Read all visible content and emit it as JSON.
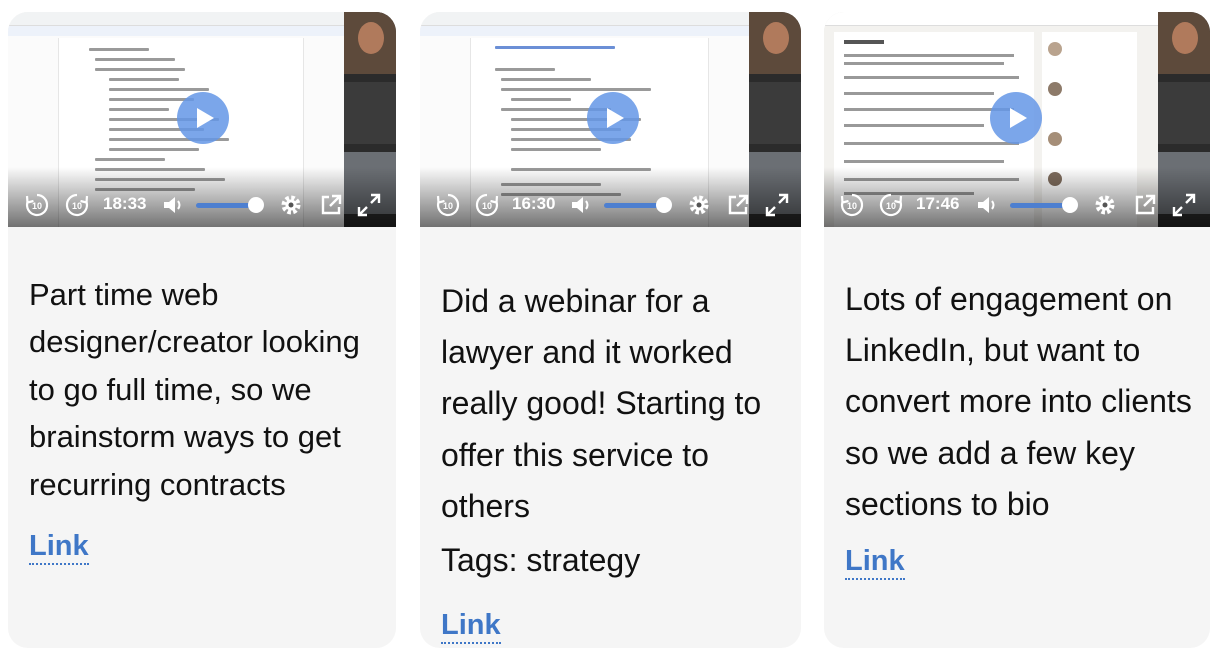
{
  "cards": [
    {
      "video": {
        "time": "18:33",
        "rewind_label": "10",
        "forward_label": "10"
      },
      "description": "Part time web designer/creator looking to go full time, so we brainstorm ways to get recurring contracts",
      "link_label": "Link"
    },
    {
      "video": {
        "time": "16:30",
        "rewind_label": "10",
        "forward_label": "10"
      },
      "description": "Did a webinar for a lawyer and it worked really good! Starting to offer this service to others",
      "tags": "Tags: strategy",
      "link_label": "Link"
    },
    {
      "video": {
        "time": "17:46",
        "rewind_label": "10",
        "forward_label": "10"
      },
      "description": "Lots of engagement on LinkedIn, but want to convert more into clients so we add a few key sections to bio",
      "link_label": "Link"
    }
  ],
  "icons": {
    "rewind": "rewind-10-icon",
    "forward": "forward-10-icon",
    "volume": "volume-icon",
    "settings": "gear-icon",
    "popout": "external-link-icon",
    "fullscreen": "fullscreen-icon",
    "play": "play-icon"
  },
  "colors": {
    "link": "#3f77c7",
    "play_button": "#6496e6",
    "volume_track": "#4d7fd0",
    "card_bg": "#f5f5f5"
  }
}
